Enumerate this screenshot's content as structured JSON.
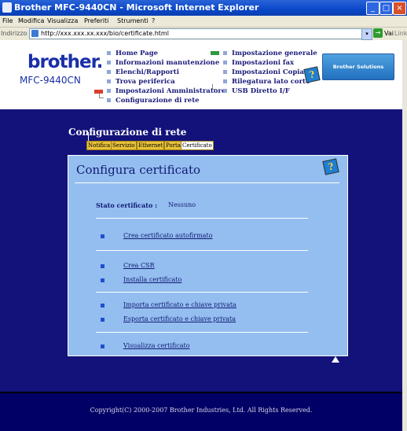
{
  "window": {
    "title": "Brother MFC-9440CN - Microsoft Internet Explorer"
  },
  "menu": {
    "items": [
      "File",
      "Modifica",
      "Visualizza",
      "Preferiti",
      "Strumenti",
      "?"
    ]
  },
  "address": {
    "label": "Indirizzo",
    "url": "http://xxx.xxx.xx.xxx/bio/certificate.html",
    "go_label": "Vai",
    "links_label": "Links"
  },
  "header": {
    "logo": "brother.",
    "model": "MFC-9440CN",
    "nav_left": [
      "Home Page",
      "Informazioni manutenzione",
      "Elenchi/Rapporti",
      "Trova periferica",
      "Impostazioni Amministratore",
      "Configurazione di rete"
    ],
    "nav_right": [
      "Impostazione generale",
      "Impostazioni fax",
      "Impostazioni Copia",
      "Rilegatura lato corto",
      "USB Diretto I/F"
    ],
    "help_glyph": "?",
    "solutions_label": "Brother Solutions Center"
  },
  "section": {
    "title": "Configurazione di rete",
    "tabs": [
      "Notifica",
      "Servizio",
      "Ethernet",
      "Porta",
      "Certificato"
    ]
  },
  "panel": {
    "title": "Configura certificato",
    "help_glyph": "?",
    "status_label": "Stato certificato :",
    "status_value": "Nessuno",
    "items": [
      "Crea certificato autofirmato",
      "Crea CSR",
      "Installa certificato",
      "Importa certificato e chiave privata",
      "Esporta certificato e chiave privata",
      "Visualizza certificato"
    ]
  },
  "footer": {
    "copyright": "Copyright(C) 2000-2007 Brother Industries, Ltd. All Rights Reserved."
  },
  "colors": {
    "page_bg": "#13127a",
    "panel_bg": "#94bef0",
    "tab_bg": "#e8c23a",
    "footer_bg": "#000066"
  }
}
